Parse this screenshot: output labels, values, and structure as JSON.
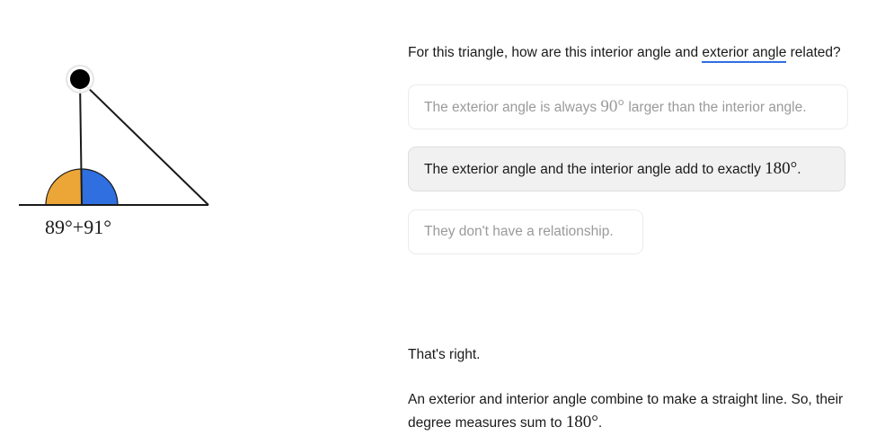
{
  "diagram": {
    "angle_label": "89°+91°",
    "colors": {
      "interior": "#ECA637",
      "exterior": "#2F6FE0",
      "line": "#1a1a1a",
      "handle": "#000000"
    }
  },
  "question": {
    "prefix": "For this triangle, how are this interior angle and ",
    "term": "exterior angle",
    "suffix": " related?"
  },
  "choices": [
    {
      "before": "The exterior angle is always ",
      "math": "90°",
      "after": " larger than the interior angle.",
      "state": "unselected"
    },
    {
      "before": "The exterior angle and the interior angle add to exactly ",
      "math": "180°",
      "after": ".",
      "state": "selected"
    },
    {
      "before": "They don't have a relationship.",
      "math": "",
      "after": "",
      "state": "unselected"
    }
  ],
  "feedback": {
    "title": "That's right.",
    "text_before": "An exterior and interior angle combine to make a straight line. So, their degree measures sum to ",
    "text_math": "180°",
    "text_after": "."
  }
}
